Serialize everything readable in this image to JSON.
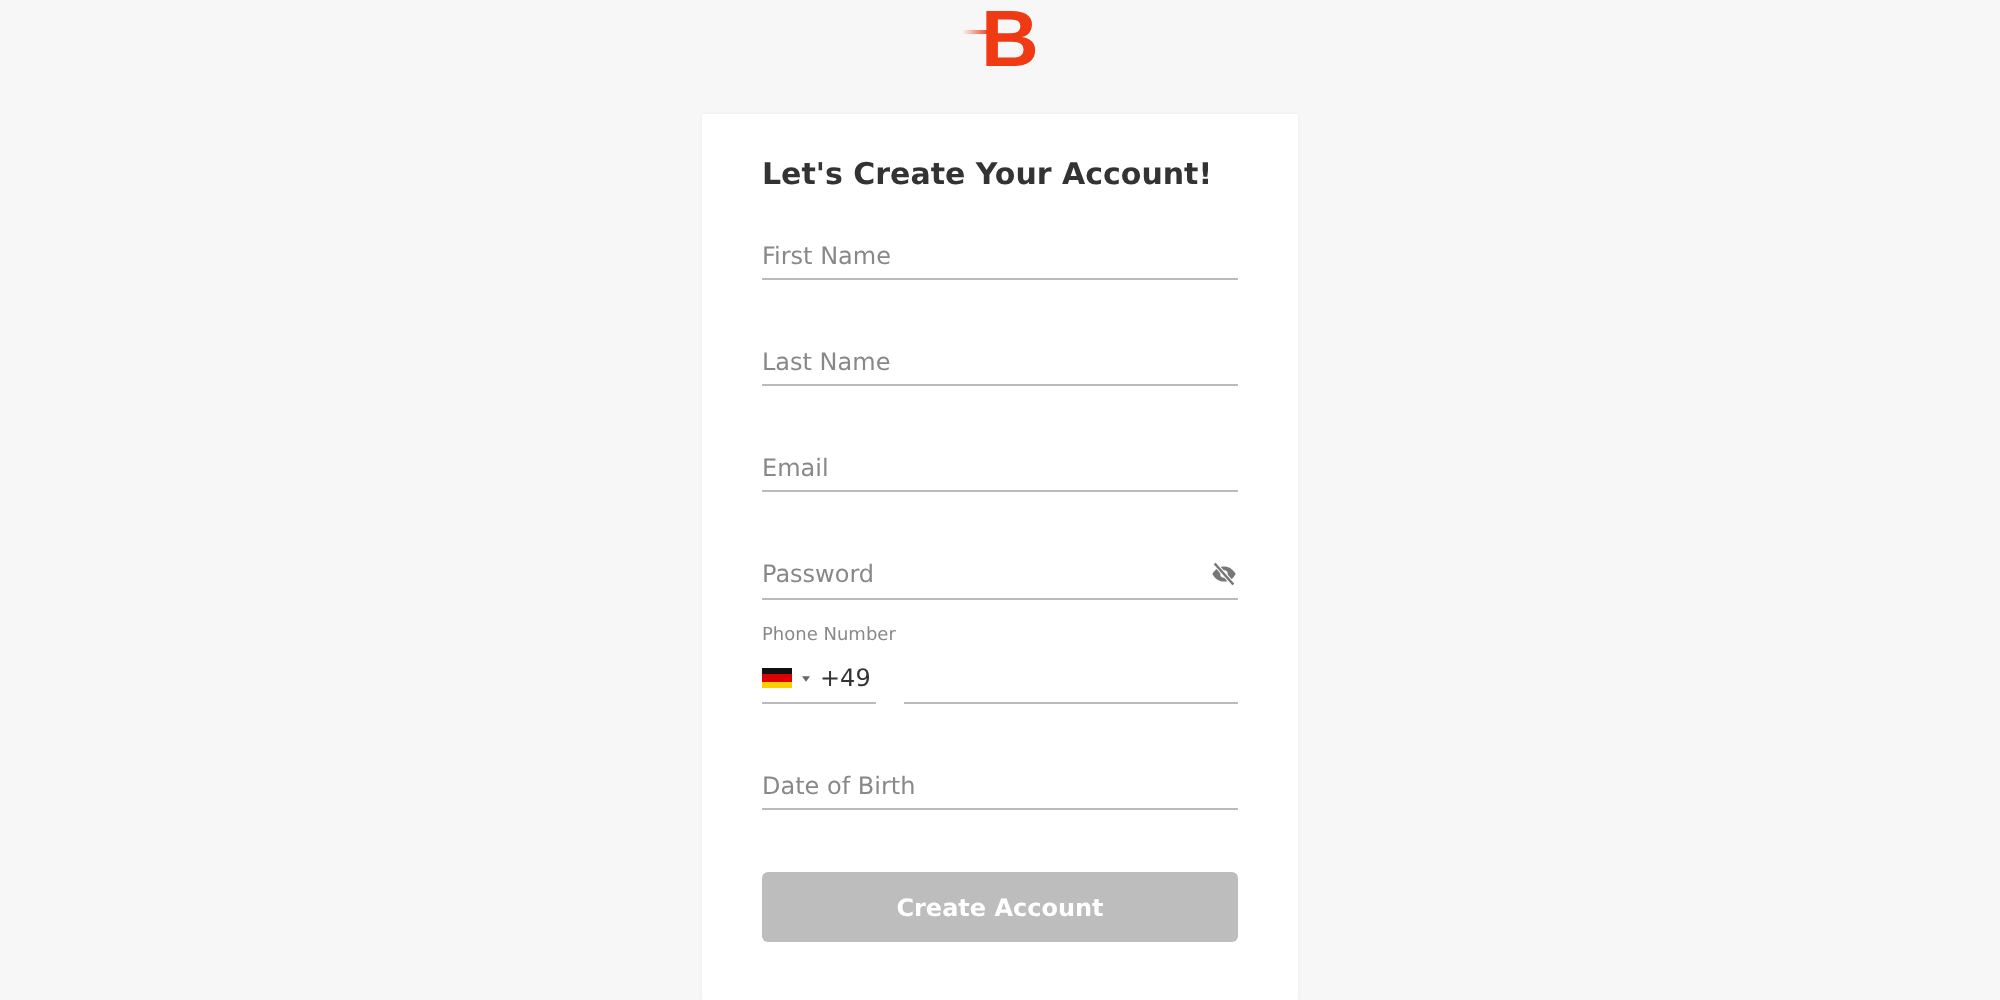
{
  "logo": {
    "text": "B"
  },
  "form": {
    "title": "Let's Create Your Account!",
    "fields": [
      {
        "kind": "text",
        "placeholder": "First Name"
      },
      {
        "kind": "text",
        "placeholder": "Last Name"
      },
      {
        "kind": "text",
        "placeholder": "Email"
      },
      {
        "kind": "password",
        "placeholder": "Password"
      },
      {
        "kind": "phone",
        "label": "Phone Number",
        "code": "+49"
      },
      {
        "kind": "text",
        "placeholder": "Date of Birth"
      }
    ],
    "button": {
      "label": "Create Account",
      "disabled": true
    }
  }
}
